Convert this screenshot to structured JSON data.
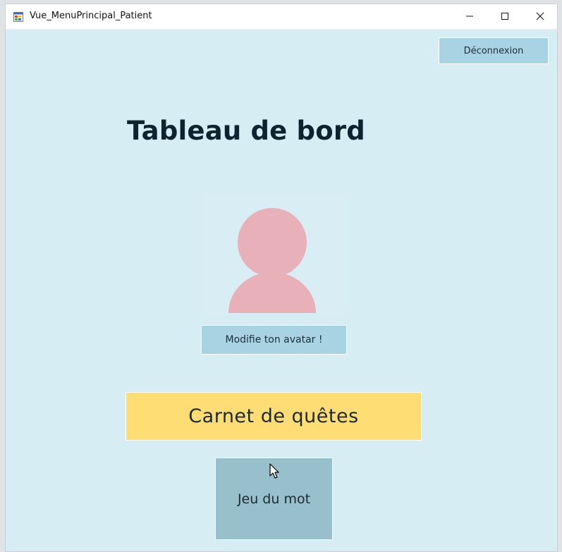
{
  "window": {
    "title": "Vue_MenuPrincipal_Patient",
    "icon": "app-window-icon",
    "controls": {
      "minimize_icon": "minimize-icon",
      "maximize_icon": "maximize-icon",
      "close_icon": "close-icon"
    }
  },
  "header": {
    "logout_label": "Déconnexion"
  },
  "main": {
    "title": "Tableau de bord",
    "avatar_icon": "user-avatar-icon",
    "avatar_button_label": "Modifie ton avatar !",
    "quests_button_label": "Carnet de quêtes",
    "game_button_label": "Jeu du mot"
  },
  "colors": {
    "background": "#d7edf4",
    "button": "#a8d3e2",
    "quests": "#fddd74",
    "game": "#98c0cc",
    "avatar": "#e8b0b9",
    "title": "#0d2430"
  }
}
